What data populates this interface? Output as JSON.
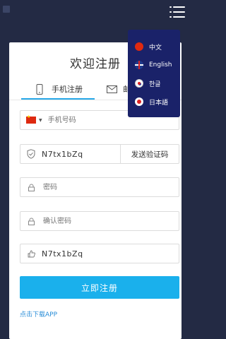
{
  "header": {
    "app_icon": "app-square-icon",
    "menu_icon": "list-menu-icon"
  },
  "page": {
    "title": "欢迎注册",
    "tabs": [
      {
        "label": "手机注册",
        "icon": "phone-icon",
        "active": true
      },
      {
        "label": "邮",
        "icon": "mail-icon",
        "active": false
      }
    ]
  },
  "form": {
    "phone": {
      "country_flag": "china-flag-icon",
      "placeholder": "手机号码"
    },
    "verification": {
      "value": "N7tx1bZq",
      "icon": "shield-check-icon",
      "send_label": "发送验证码"
    },
    "password": {
      "placeholder": "密码",
      "icon": "lock-icon"
    },
    "confirm_password": {
      "placeholder": "确认密码",
      "icon": "lock-icon"
    },
    "invite": {
      "value": "N7tx1bZq",
      "icon": "thumbs-up-icon"
    },
    "submit_label": "立即注册",
    "download_link": "点击下载APP"
  },
  "language_menu": {
    "items": [
      {
        "label": "中文",
        "flag": "china-flag-icon"
      },
      {
        "label": "English",
        "flag": "uk-flag-icon"
      },
      {
        "label": "한글",
        "flag": "korea-flag-icon"
      },
      {
        "label": "日本語",
        "flag": "japan-flag-icon"
      }
    ]
  },
  "colors": {
    "background": "#232a44",
    "accent": "#1ab0ec",
    "menu_bg": "#1a2269",
    "link": "#2a8ed8"
  }
}
